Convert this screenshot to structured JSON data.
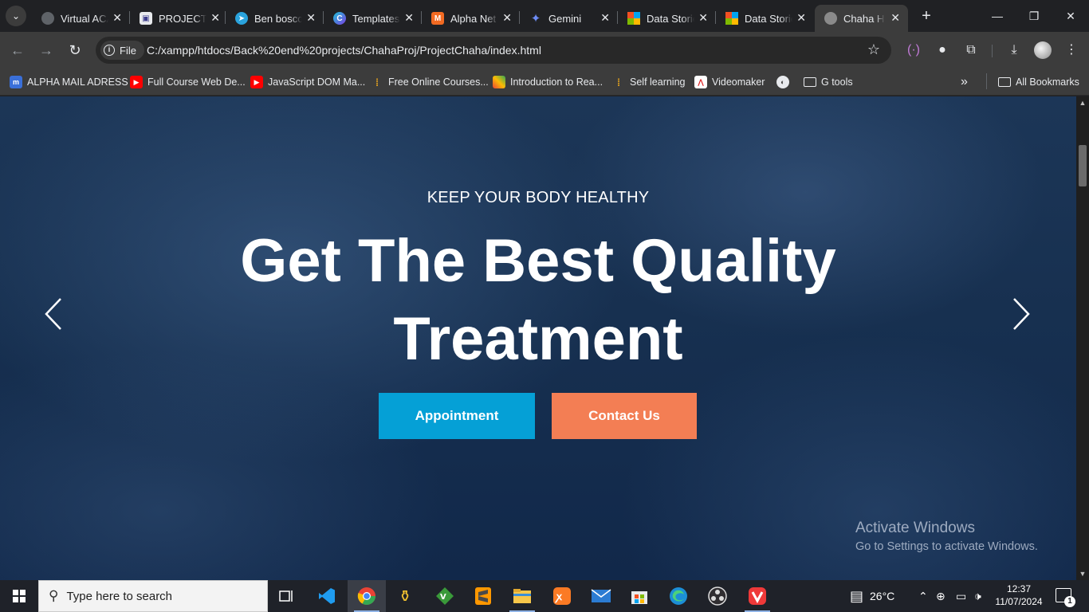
{
  "browser": {
    "tabs": [
      {
        "title": "Virtual ACA",
        "icon": "globe-icon",
        "active": false
      },
      {
        "title": "PROJECT|",
        "icon": "document-icon",
        "active": false
      },
      {
        "title": "Ben boscom",
        "icon": "telegram-icon",
        "active": false
      },
      {
        "title": "Templates",
        "icon": "canva-icon",
        "active": false
      },
      {
        "title": "Alpha Net",
        "icon": "mail-m-icon",
        "active": false
      },
      {
        "title": "Gemini",
        "icon": "gemini-icon",
        "active": false
      },
      {
        "title": "Data Storie",
        "icon": "microsoft-icon",
        "active": false
      },
      {
        "title": "Data Storie",
        "icon": "microsoft-icon",
        "active": false
      },
      {
        "title": "Chaha Ho",
        "icon": "globe-icon",
        "active": true
      }
    ],
    "close_glyph": "✕",
    "new_tab_glyph": "+",
    "site_chip_label": "File",
    "url": "C:/xampp/htdocs/Back%20end%20projects/ChahaProj/ProjectChaha/index.html",
    "bookmarks": [
      {
        "label": "ALPHA MAIL ADRESS",
        "icon": "m-icon"
      },
      {
        "label": "Full Course Web De...",
        "icon": "youtube-icon"
      },
      {
        "label": "JavaScript DOM Ma...",
        "icon": "youtube-icon"
      },
      {
        "label": "Free Online Courses...",
        "icon": "bars-icon"
      },
      {
        "label": "Introduction to Rea...",
        "icon": "colorful-icon"
      },
      {
        "label": "Self learning",
        "icon": "bars-icon"
      },
      {
        "label": "Videomaker",
        "icon": "videomaker-icon"
      },
      {
        "label": "",
        "icon": "globe-icon"
      },
      {
        "label": "G tools",
        "icon": "folder-icon"
      }
    ],
    "all_bookmarks_label": "All Bookmarks",
    "overflow_glyph": "»"
  },
  "hero": {
    "subtitle": "KEEP YOUR BODY HEALTHY",
    "title_line1": "Get The Best Quality",
    "title_line2": "Treatment",
    "appointment_label": "Appointment",
    "contact_label": "Contact Us"
  },
  "watermark": {
    "line1": "Activate Windows",
    "line2": "Go to Settings to activate Windows."
  },
  "taskbar": {
    "search_placeholder": "Type here to search",
    "temperature": "26°C",
    "time": "12:37",
    "date": "11/07/2024",
    "notification_count": "1",
    "apps": [
      "task-view-icon",
      "vscode-icon",
      "chrome-icon",
      "lamp-icon",
      "vim-icon",
      "sublime-icon",
      "file-explorer-icon",
      "xampp-icon",
      "mail-icon",
      "store-icon",
      "edge-icon",
      "obs-icon",
      "vivaldi-icon"
    ]
  },
  "colors": {
    "appointment": "#05a0d6",
    "contact": "#f37e54",
    "hero_bg": "#173050"
  }
}
